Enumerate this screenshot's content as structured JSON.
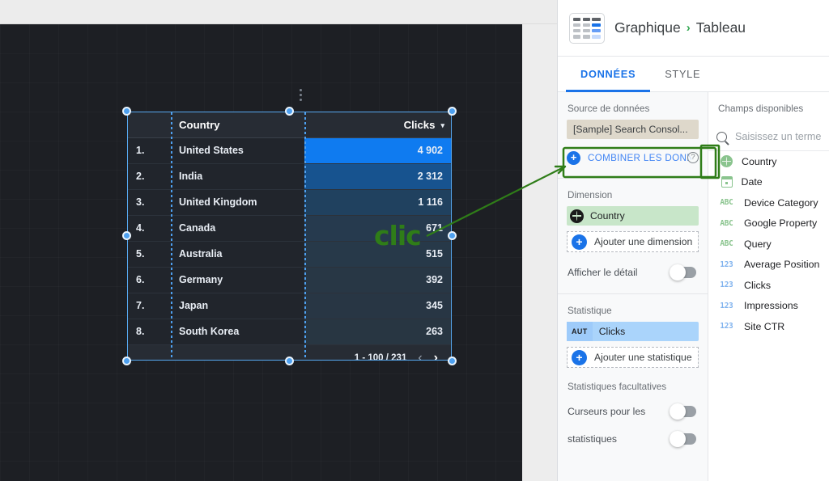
{
  "header": {
    "icon": "table-chart-icon",
    "breadcrumb_root": "Graphique",
    "breadcrumb_sep": "›",
    "breadcrumb_leaf": "Tableau"
  },
  "tabs": [
    {
      "label": "DONNÉES",
      "active": true
    },
    {
      "label": "STYLE",
      "active": false
    }
  ],
  "properties": {
    "data_source_label": "Source de données",
    "data_source_value": "[Sample] Search Consol...",
    "combine_label": "COMBINER LES DONN",
    "combine_help": "?",
    "dimension_label": "Dimension",
    "dimension_value": "Country",
    "add_dimension_label": "Ajouter une dimension",
    "show_detail_label": "Afficher le détail",
    "metric_label": "Statistique",
    "metric_badge": "AUT",
    "metric_value": "Clicks",
    "add_metric_label": "Ajouter une statistique",
    "optional_metrics_label": "Statistiques facultatives",
    "sliders_label_line1": "Curseurs pour les",
    "sliders_label_line2": "statistiques"
  },
  "fields_panel": {
    "title": "Champs disponibles",
    "search_placeholder": "Saisissez un terme",
    "search_value": "",
    "items": [
      {
        "name": "Country",
        "type": "geo",
        "badge": ""
      },
      {
        "name": "Date",
        "type": "date",
        "badge": ""
      },
      {
        "name": "Device Category",
        "type": "text",
        "badge": "ABC"
      },
      {
        "name": "Google Property",
        "type": "text",
        "badge": "ABC"
      },
      {
        "name": "Query",
        "type": "text",
        "badge": "ABC"
      },
      {
        "name": "Average Position",
        "type": "num",
        "badge": "123"
      },
      {
        "name": "Clicks",
        "type": "num",
        "badge": "123"
      },
      {
        "name": "Impressions",
        "type": "num",
        "badge": "123"
      },
      {
        "name": "Site CTR",
        "type": "num",
        "badge": "123"
      }
    ]
  },
  "table_widget": {
    "columns": [
      "Country",
      "Clicks"
    ],
    "sort_caret": "▾",
    "rows": [
      {
        "rank": "1.",
        "country": "United States",
        "clicks": "4 902",
        "bar": 1.0,
        "fill": "#0f7bf0"
      },
      {
        "rank": "2.",
        "country": "India",
        "clicks": "2 312",
        "bar": 1.0,
        "fill": "#17538f"
      },
      {
        "rank": "3.",
        "country": "United Kingdom",
        "clicks": "1 116",
        "bar": 1.0,
        "fill": "#20415f"
      },
      {
        "rank": "4.",
        "country": "Canada",
        "clicks": "671",
        "bar": 1.0,
        "fill": "#263a4e"
      },
      {
        "rank": "5.",
        "country": "Australia",
        "clicks": "515",
        "bar": 1.0,
        "fill": "#273949"
      },
      {
        "rank": "6.",
        "country": "Germany",
        "clicks": "392",
        "bar": 1.0,
        "fill": "#283745"
      },
      {
        "rank": "7.",
        "country": "Japan",
        "clicks": "345",
        "bar": 1.0,
        "fill": "#283644"
      },
      {
        "rank": "8.",
        "country": "South Korea",
        "clicks": "263",
        "bar": 1.0,
        "fill": "#283642"
      }
    ],
    "pagination": "1 - 100 / 231",
    "prev_arrow": "‹",
    "next_arrow": "›"
  },
  "annotations": {
    "click_label": "clic",
    "highlight_color": "#2f7d18"
  }
}
